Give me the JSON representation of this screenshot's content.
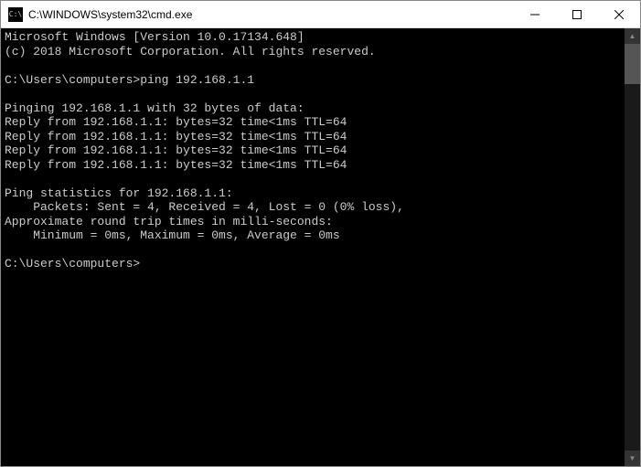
{
  "titlebar": {
    "icon_label": "C:\\",
    "title": "C:\\WINDOWS\\system32\\cmd.exe"
  },
  "window_controls": {
    "minimize": "Minimize",
    "maximize": "Maximize",
    "close": "Close"
  },
  "console": {
    "lines": [
      "Microsoft Windows [Version 10.0.17134.648]",
      "(c) 2018 Microsoft Corporation. All rights reserved.",
      "",
      "C:\\Users\\computers>ping 192.168.1.1",
      "",
      "Pinging 192.168.1.1 with 32 bytes of data:",
      "Reply from 192.168.1.1: bytes=32 time<1ms TTL=64",
      "Reply from 192.168.1.1: bytes=32 time<1ms TTL=64",
      "Reply from 192.168.1.1: bytes=32 time<1ms TTL=64",
      "Reply from 192.168.1.1: bytes=32 time<1ms TTL=64",
      "",
      "Ping statistics for 192.168.1.1:",
      "    Packets: Sent = 4, Received = 4, Lost = 0 (0% loss),",
      "Approximate round trip times in milli-seconds:",
      "    Minimum = 0ms, Maximum = 0ms, Average = 0ms",
      "",
      "C:\\Users\\computers>"
    ]
  },
  "scrollbar": {
    "up": "▲",
    "down": "▼"
  }
}
